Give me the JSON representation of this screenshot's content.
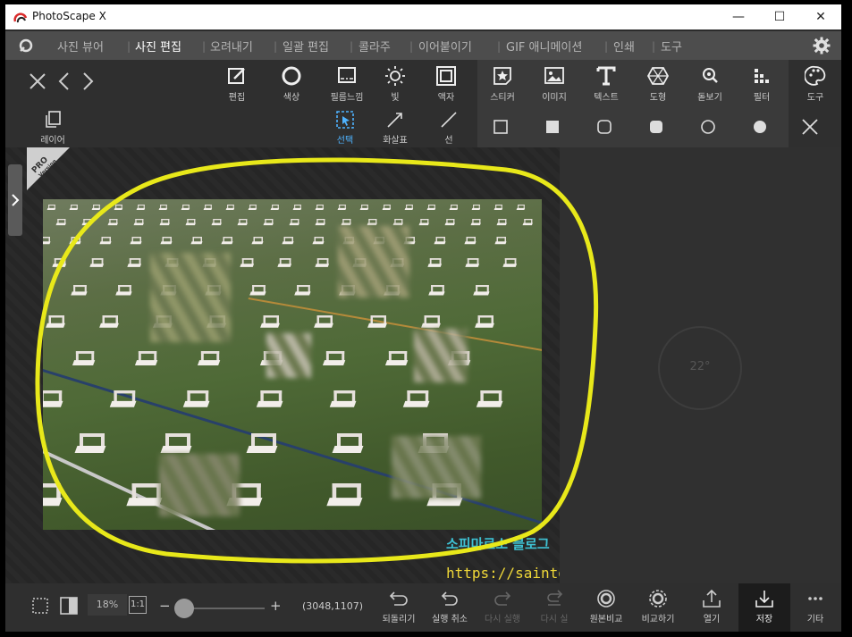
{
  "window": {
    "title": "PhotoScape X",
    "minimize": "—",
    "maximize": "☐",
    "close": "✕"
  },
  "menu": {
    "items": [
      "사진 뷰어",
      "사진 편집",
      "오려내기",
      "일괄 편집",
      "콜라주",
      "이어붙이기",
      "GIF 애니메이션",
      "인쇄",
      "도구"
    ],
    "active_index": 1
  },
  "toolbar_main": {
    "tools": [
      {
        "label": "편집",
        "icon": "edit-icon"
      },
      {
        "label": "색상",
        "icon": "color-icon"
      },
      {
        "label": "필름느낌",
        "icon": "film-icon"
      },
      {
        "label": "빛",
        "icon": "light-icon"
      },
      {
        "label": "액자",
        "icon": "frame-icon"
      },
      {
        "label": "스티커",
        "icon": "sticker-icon"
      },
      {
        "label": "이미지",
        "icon": "image-icon"
      },
      {
        "label": "텍스트",
        "icon": "text-icon"
      },
      {
        "label": "도형",
        "icon": "shape-icon"
      },
      {
        "label": "돋보기",
        "icon": "magnifier-icon"
      },
      {
        "label": "필터",
        "icon": "filter-icon"
      },
      {
        "label": "도구",
        "icon": "tools-icon"
      }
    ]
  },
  "toolbar_sub": {
    "layer": "레이어",
    "tools": [
      {
        "label": "선택",
        "icon": "select-icon",
        "active": true
      },
      {
        "label": "화살표",
        "icon": "arrow-icon"
      },
      {
        "label": "선",
        "icon": "line-icon"
      }
    ],
    "shapes": [
      "square-outline-icon",
      "square-filled-icon",
      "rounded-square-outline-icon",
      "rounded-square-filled-icon",
      "circle-outline-icon",
      "circle-filled-icon"
    ]
  },
  "canvas": {
    "pro_badge": "PRO",
    "pro_sub": "Version",
    "angle": "22°"
  },
  "watermark": {
    "line1": "소피마르소 블로그",
    "line2": "https://saintone.tistory.com"
  },
  "bottom": {
    "zoom": "18%",
    "zoom_reset": "1:1",
    "minus": "−",
    "plus": "+",
    "coords": "(3048,1107)",
    "zoom_level": 0.18,
    "tools": [
      {
        "label": "되돌리기",
        "disabled": false
      },
      {
        "label": "실행 취소",
        "disabled": false
      },
      {
        "label": "다시 실행",
        "disabled": true
      },
      {
        "label": "다시 실",
        "disabled": true
      },
      {
        "label": "원본비교",
        "disabled": false
      },
      {
        "label": "비교하기",
        "disabled": false
      },
      {
        "label": "열기",
        "disabled": false
      },
      {
        "label": "저장",
        "disabled": false
      },
      {
        "label": "기타",
        "disabled": false
      }
    ]
  },
  "colors": {
    "highlight": "#e8e81a",
    "active_tab": "#4fb3ff",
    "watermark_blue": "#3ec1d3",
    "watermark_yellow": "#f0d838"
  }
}
